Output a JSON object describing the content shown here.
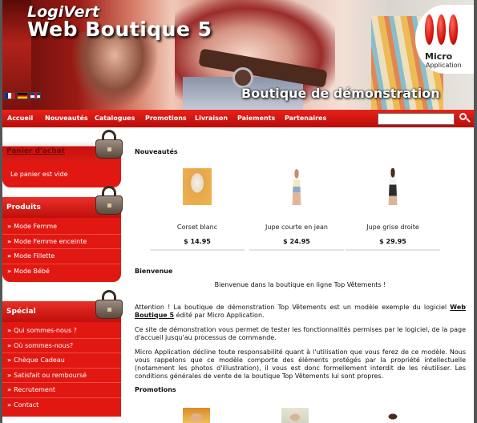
{
  "header": {
    "logo_line1": "LogiVert",
    "logo_line2": "Web Boutique 5",
    "tagline": "Boutique de démonstration",
    "brand_line1": "Micro",
    "brand_line2": "Application",
    "languages": [
      "fr-flag-icon",
      "de-flag-icon",
      "uk-flag-icon"
    ]
  },
  "nav": {
    "items": [
      "Accueil",
      "Nouveautés",
      "Catalogues",
      "Promotions",
      "Livraison",
      "Paiements",
      "Partenaires"
    ],
    "search_value": "",
    "search_icon": "search-icon"
  },
  "sidebar": {
    "cart": {
      "title": "Panier d'achat",
      "text": "Le panier est vide"
    },
    "products": {
      "title": "Produits",
      "items": [
        "Mode Femme",
        "Mode Femme enceinte",
        "Mode Fillette",
        "Mode Bébé"
      ]
    },
    "special": {
      "title": "Spécial",
      "items": [
        "Qui sommes-nous ?",
        "Où sommes-nous?",
        "Chèque Cadeau",
        "Satisfait ou remboursé",
        "Recrutement",
        "Contact"
      ]
    }
  },
  "main": {
    "new_title": "Nouveautés",
    "products": [
      {
        "name": "Corset blanc",
        "price": "$ 14.95"
      },
      {
        "name": "Jupe courte en jean",
        "price": "$ 24.95"
      },
      {
        "name": "Jupe grise droite",
        "price": "$ 29.95"
      }
    ],
    "welcome_title": "Bienvenue",
    "welcome_text": "Bienvenue dans la boutique en ligne Top Vêtements !",
    "para1_pre": "Attention ! La boutique de démonstration Top Vêtements est un modèle exemple du logiciel ",
    "para1_link": "Web Boutique 5",
    "para1_post": " édité par Micro Application.",
    "para2": "Ce site de démonstration vous permet de tester les fonctionnalités permises par le logiciel, de la page d'accueil jusqu'au processus de commande.",
    "para3": "Micro Application décline toute responsabilité quant à l'utilisation que vous ferez de ce modèle. Nous vous rappelons que ce modèle comporte des éléments protégés par la propriété intellectuelle (notamment les photos d'illustration), il vous est donc formellement interdit de les réutiliser. Les conditions générales de vente de la boutique Top Vêtements lui sont propres.",
    "promo_title": "Promotions"
  }
}
